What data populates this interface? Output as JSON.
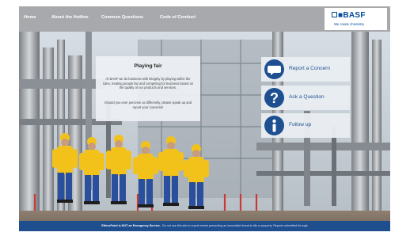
{
  "nav": {
    "items": [
      "Home",
      "About the Hotline",
      "Common Questions",
      "Code of Conduct"
    ]
  },
  "logo": {
    "brand": "BASF",
    "tagline": "We create chemistry",
    "color": "#004a96"
  },
  "info": {
    "title": "Playing fair",
    "paragraph1": "At BASF we do business with integrity by playing within the rules, treating people fair and competing for business based on the quality of our products and services.",
    "paragraph2": "Should you ever perceive us differently, please speak up and report your concerns!"
  },
  "actions": [
    {
      "label": "Report a Concern",
      "icon": "chat-bubble-icon"
    },
    {
      "label": "Ask a Question",
      "icon": "question-mark-icon"
    },
    {
      "label": "Follow up",
      "icon": "info-icon"
    }
  ],
  "footer": {
    "bold": "EthicsPoint is NOT an Emergency Service.",
    "text": "Do not use this site to report events presenting an immediate threat to life or property. Reports submitted through"
  },
  "colors": {
    "nav_bg": "#a7a9ac",
    "accent": "#1d4f91",
    "worker_jacket": "#f2c21b",
    "worker_pants": "#2a4f9c"
  }
}
